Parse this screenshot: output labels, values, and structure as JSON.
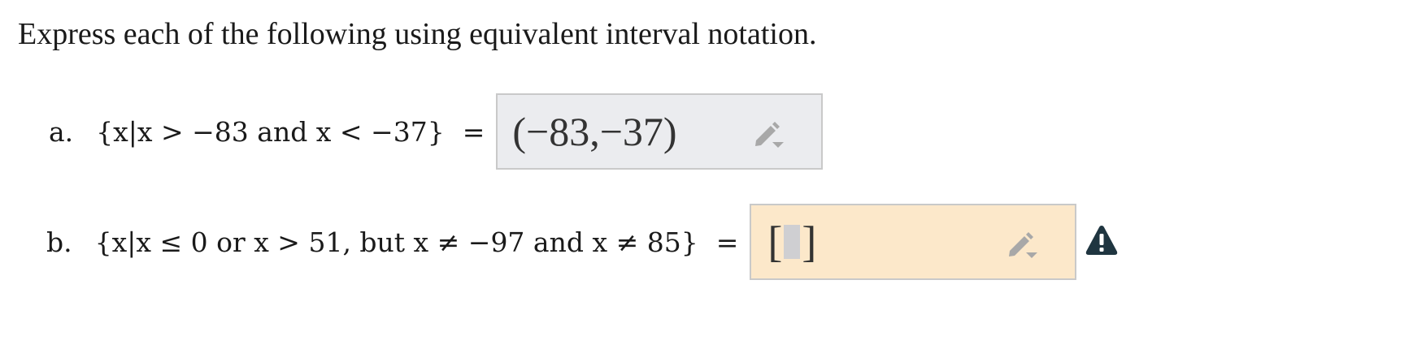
{
  "instruction": "Express each of the following using equivalent interval notation.",
  "questions": [
    {
      "letter": "a.",
      "expression": "{x|x > −83 and x < −37}",
      "equals": "=",
      "answer": "(−83,−37)",
      "state": "submitted"
    },
    {
      "letter": "b.",
      "expression": "{x|x ≤ 0 or x > 51, but x ≠ −97 and x ≠ 85}",
      "equals": "=",
      "answer_open": "[",
      "answer_close": "]",
      "state": "warning"
    }
  ],
  "icons": {
    "edit": "pencil-dropdown-icon",
    "warning": "warning-triangle-icon"
  },
  "colors": {
    "submitted_bg": "#ebecef",
    "warning_bg": "#fce8ca",
    "warning_icon": "#1f3540",
    "icon_gray": "#a8a8a8"
  }
}
